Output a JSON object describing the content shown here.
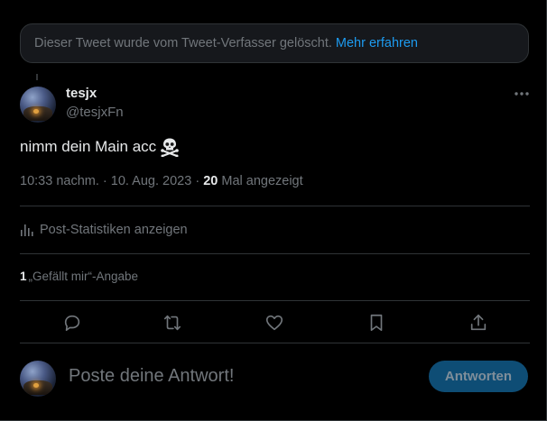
{
  "deleted_notice": {
    "text": "Dieser Tweet wurde vom Tweet-Verfasser gelöscht.",
    "link": "Mehr erfahren"
  },
  "tweet": {
    "display_name": "tesjx",
    "handle": "@tesjxFn",
    "text": "nimm dein Main acc",
    "emoji": "skull-and-crossbones-icon",
    "time": "10:33 nachm.",
    "separator": "·",
    "date": "10. Aug. 2023",
    "views_count": "20",
    "views_label": "Mal angezeigt"
  },
  "stats": {
    "label": "Post-Statistiken anzeigen"
  },
  "likes": {
    "count": "1",
    "label": "„Gefällt mir“-Angabe"
  },
  "actions": [
    "reply-icon",
    "retweet-icon",
    "like-icon",
    "bookmark-icon",
    "share-icon"
  ],
  "reply_box": {
    "placeholder": "Poste deine Antwort!",
    "button": "Antworten"
  },
  "colors": {
    "background": "#000000",
    "border": "#2f3336",
    "text_primary": "#e7e9ea",
    "text_secondary": "#71767b",
    "link": "#1d9bf0",
    "reply_button_disabled": "#0e4d75"
  }
}
